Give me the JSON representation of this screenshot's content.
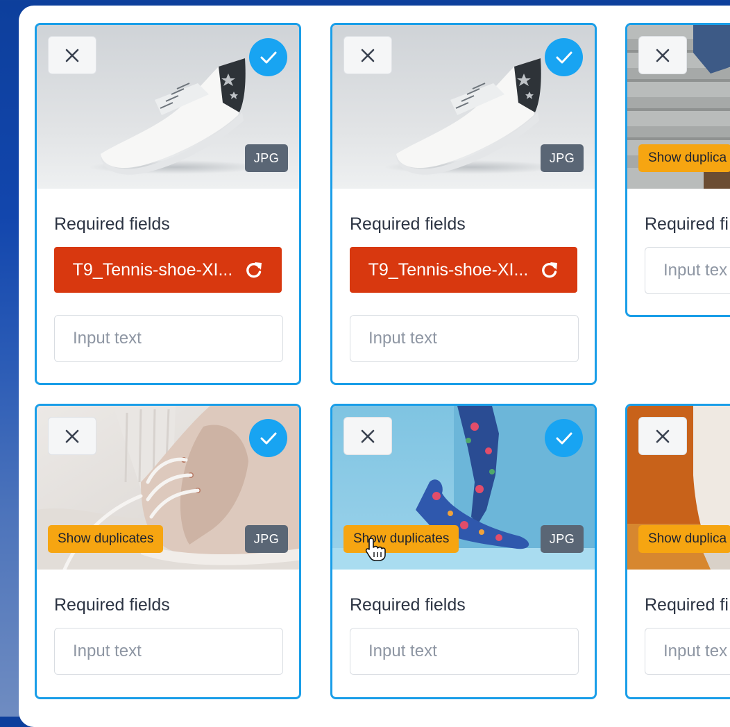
{
  "cards": [
    {
      "section_label": "Required fields",
      "file_name": "T9_Tennis-shoe-XI...",
      "input_placeholder": "Input text",
      "badge": "JPG",
      "selected": true
    },
    {
      "section_label": "Required fields",
      "file_name": "T9_Tennis-shoe-XI...",
      "input_placeholder": "Input text",
      "badge": "JPG",
      "selected": true
    },
    {
      "section_label": "Required fi",
      "input_placeholder": "Input tex",
      "duplicate_label": "Show duplica"
    },
    {
      "section_label": "Required fields",
      "input_placeholder": "Input text",
      "badge": "JPG",
      "duplicate_label": "Show duplicates",
      "selected": true
    },
    {
      "section_label": "Required fields",
      "input_placeholder": "Input text",
      "badge": "JPG",
      "duplicate_label": "Show duplicates",
      "selected": true
    },
    {
      "section_label": "Required fi",
      "input_placeholder": "Input tex",
      "duplicate_label": "Show duplica"
    }
  ],
  "icons": {
    "remove": "close-icon",
    "selected": "checkmark-icon",
    "retry": "refresh-icon",
    "pointer": "hand-pointer-icon"
  },
  "colors": {
    "card_border": "#1a9ee8",
    "check": "#18a4f2",
    "error_file": "#d8380f",
    "duplicates": "#f6a511",
    "badge": "#5a6675"
  }
}
